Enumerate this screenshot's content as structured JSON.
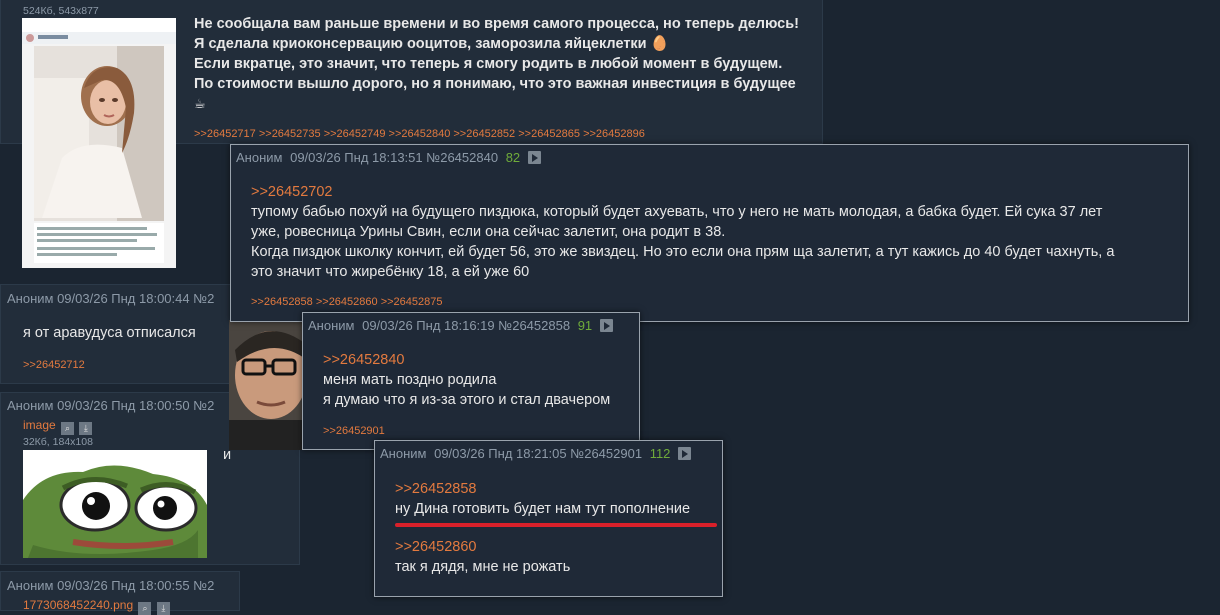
{
  "op_post": {
    "file_meta": "524Кб, 543x877",
    "text_lines": [
      "Не сообщала вам раньше времени и во время самого процесса, но теперь делюсь!",
      "Я сделала криоконсервацию ооцитов, заморозила яйцеклетки",
      "Если вкратце, это значит, что теперь я смогу родить в любой момент в будущем.",
      "По стоимости вышло дорого, но я понимаю, что это важная инвестиция в будущее"
    ],
    "egg_emoji": "🥚",
    "coffee_emoji": "☕",
    "replies": ">>26452717 >>26452735 >>26452749 >>26452840 >>26452852 >>26452865 >>26452896",
    "thumb_icons": [
      "egg-icon",
      "coffee-icon"
    ]
  },
  "post_aravudus": {
    "header": "Аноним  09/03/26 Пнд 18:00:44  №2",
    "text": "я от аравудуса отписался",
    "reply": ">>26452712"
  },
  "post_image": {
    "header": "Аноним  09/03/26 Пнд 18:00:50  №2",
    "file_name": "image",
    "file_meta": "32Кб, 184x108",
    "trailing_text": "и"
  },
  "post_bottom": {
    "header": "Аноним  09/03/26 Пнд 18:00:55  №2",
    "file_name": "1773068452240.png"
  },
  "popup1": {
    "author": "Аноним",
    "date": "09/03/26 Пнд 18:13:51",
    "num": "№26452840",
    "count": "82",
    "quote": ">>26452702",
    "lines": [
      "тупому бабью похуй на будущего пиздюка, который будет ахуевать, что у него не мать молодая, а бабка будет. Ей сука 37 лет",
      "уже, ровесница Урины Свин, если она сейчас залетит, она родит в 38.",
      "Когда пиздюк школку кончит, ей будет 56, это же звиздец. Но это если она прям ща залетит, а тут кажись до 40 будет чахнуть, а",
      "это значит что жиребёнку 18, а ей уже 60"
    ],
    "replies": ">>26452858 >>26452860 >>26452875"
  },
  "popup2": {
    "author": "Аноним",
    "date": "09/03/26 Пнд 18:16:19",
    "num": "№26452858",
    "count": "91",
    "quote": ">>26452840",
    "lines": [
      "меня мать поздно родила",
      "я думаю что я из-за этого и стал двачером"
    ],
    "replies": ">>26452901"
  },
  "popup3": {
    "author": "Аноним",
    "date": "09/03/26 Пнд 18:21:05",
    "num": "№26452901",
    "count": "112",
    "quote1": ">>26452858",
    "line1": "ну Дина готовить будет нам тут пополнение",
    "quote2": ">>26452860",
    "line2": "так я дядя, мне не рожать"
  },
  "colors": {
    "background": "#1b2531",
    "post_bg": "#222d3a",
    "link": "#e37a3f",
    "counter": "#6fab3a",
    "underline": "#d9202a"
  }
}
